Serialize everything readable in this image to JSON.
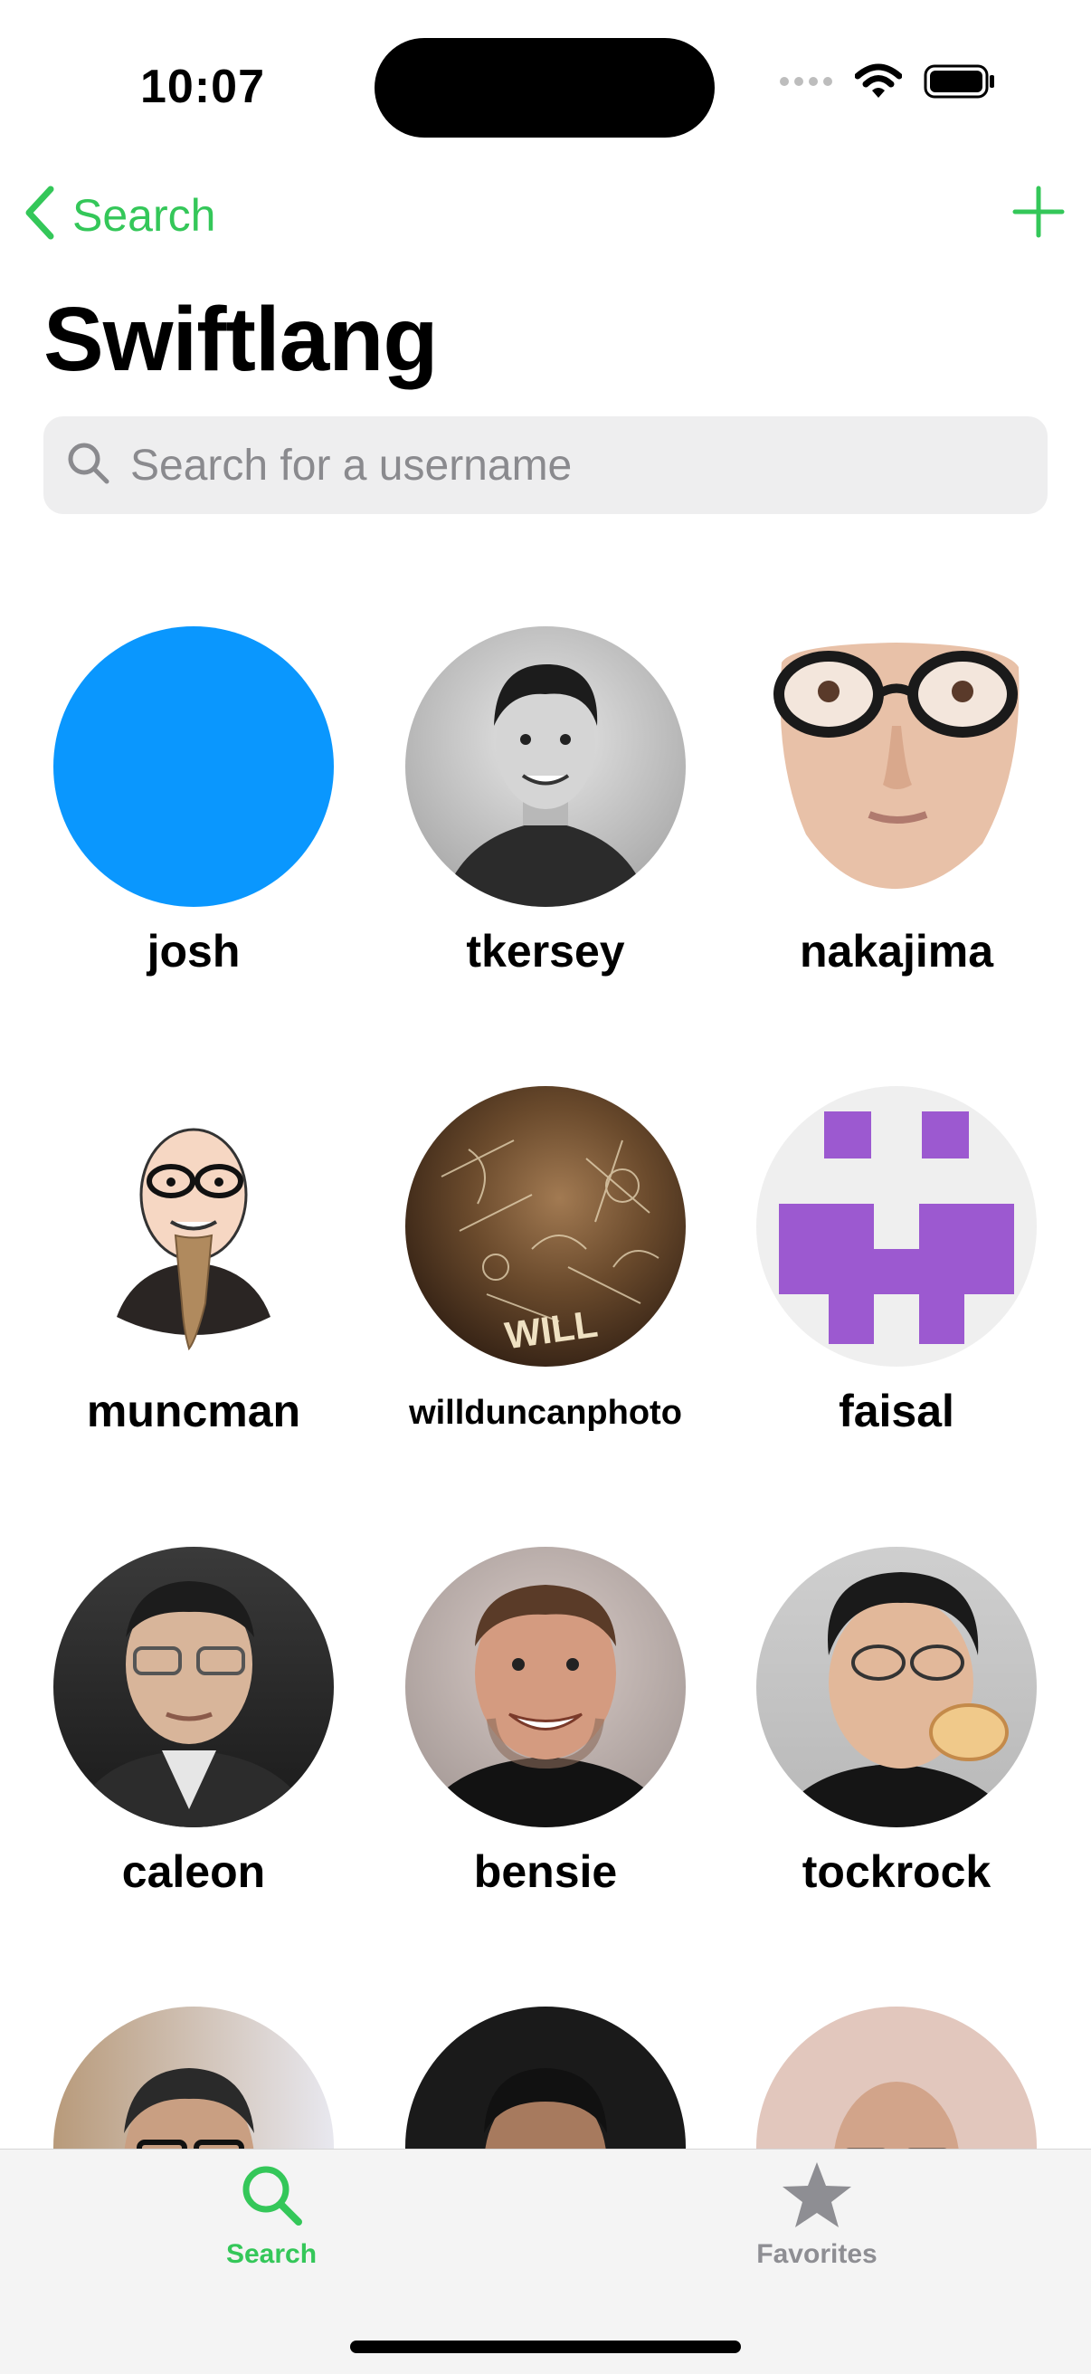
{
  "status_bar": {
    "time": "10:07"
  },
  "nav": {
    "back_label": "Search"
  },
  "page": {
    "title": "Swiftlang"
  },
  "search": {
    "placeholder": "Search for a username",
    "value": ""
  },
  "users": [
    {
      "username": "josh",
      "avatar": "solid-blue"
    },
    {
      "username": "tkersey",
      "avatar": "photo-bw-portrait"
    },
    {
      "username": "nakajima",
      "avatar": "face-cutout-glasses"
    },
    {
      "username": "muncman",
      "avatar": "cartoon-bald-beard"
    },
    {
      "username": "willduncanphoto",
      "avatar": "photo-brown-chalk"
    },
    {
      "username": "faisal",
      "avatar": "purple-pixel-face"
    },
    {
      "username": "caleon",
      "avatar": "photo-man-glasses"
    },
    {
      "username": "bensie",
      "avatar": "photo-man-smiling"
    },
    {
      "username": "tockrock",
      "avatar": "photo-man-eating"
    },
    {
      "username": "",
      "avatar": "photo-man-glasses-office"
    },
    {
      "username": "",
      "avatar": "photo-man-dark"
    },
    {
      "username": "",
      "avatar": "photo-bald-glasses"
    }
  ],
  "tabs": [
    {
      "label": "Search",
      "selected": true
    },
    {
      "label": "Favorites",
      "selected": false
    }
  ],
  "colors": {
    "accent": "#34c759",
    "blue_avatar": "#0a97fe",
    "purple": "#9c59d0",
    "inactive": "#8e8e93"
  }
}
